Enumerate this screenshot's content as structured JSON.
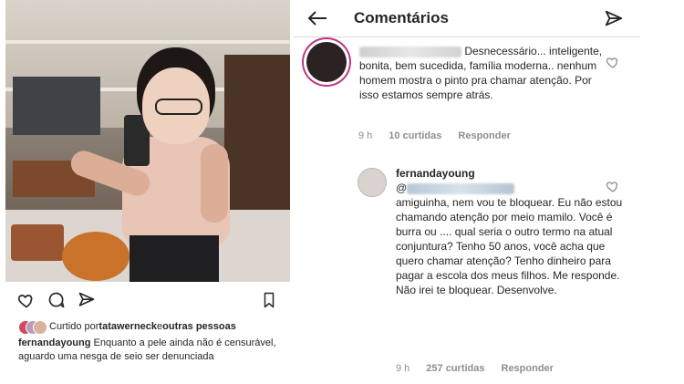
{
  "post": {
    "liked_by_text": "Curtido por ",
    "liked_by_user": "tatawerneck",
    "liked_by_suffix": " e ",
    "others_text": "outras pessoas",
    "caption_user": "fernandayoung",
    "caption_text": "Enquanto a pele ainda não é censurável, aguardo uma nesga de seio ser denunciada"
  },
  "comments_panel": {
    "title": "Comentários",
    "comments": [
      {
        "username_hidden": true,
        "text": "Desnecessário... inteligente, bonita, bem sucedida, família moderna.. nenhum homem mostra o pinto pra chamar atenção. Por isso estamos sempre atrás.",
        "time": "9 h",
        "likes": "10 curtidas",
        "reply": "Responder"
      },
      {
        "username": "fernandayoung",
        "mention_prefix": "@",
        "text": "amiguinha, nem vou te bloquear. Eu não estou chamando atenção por meio mamilo. Você é burra ou .... qual seria o outro termo na atual conjuntura? Tenho 50 anos, você acha que quero chamar atenção? Tenho dinheiro para pagar a escola dos meus filhos. Me responde. Não irei te bloquear. Desenvolve.",
        "time": "9 h",
        "likes": "257 curtidas",
        "reply": "Responder"
      }
    ]
  },
  "icons": [
    "heart-icon",
    "comment-icon",
    "share-icon",
    "bookmark-icon",
    "back-arrow-icon",
    "send-icon"
  ],
  "colors": {
    "text": "#262626",
    "muted": "#8e8e8e",
    "divider": "#dbdbdb",
    "story_ring": "#c13584"
  }
}
